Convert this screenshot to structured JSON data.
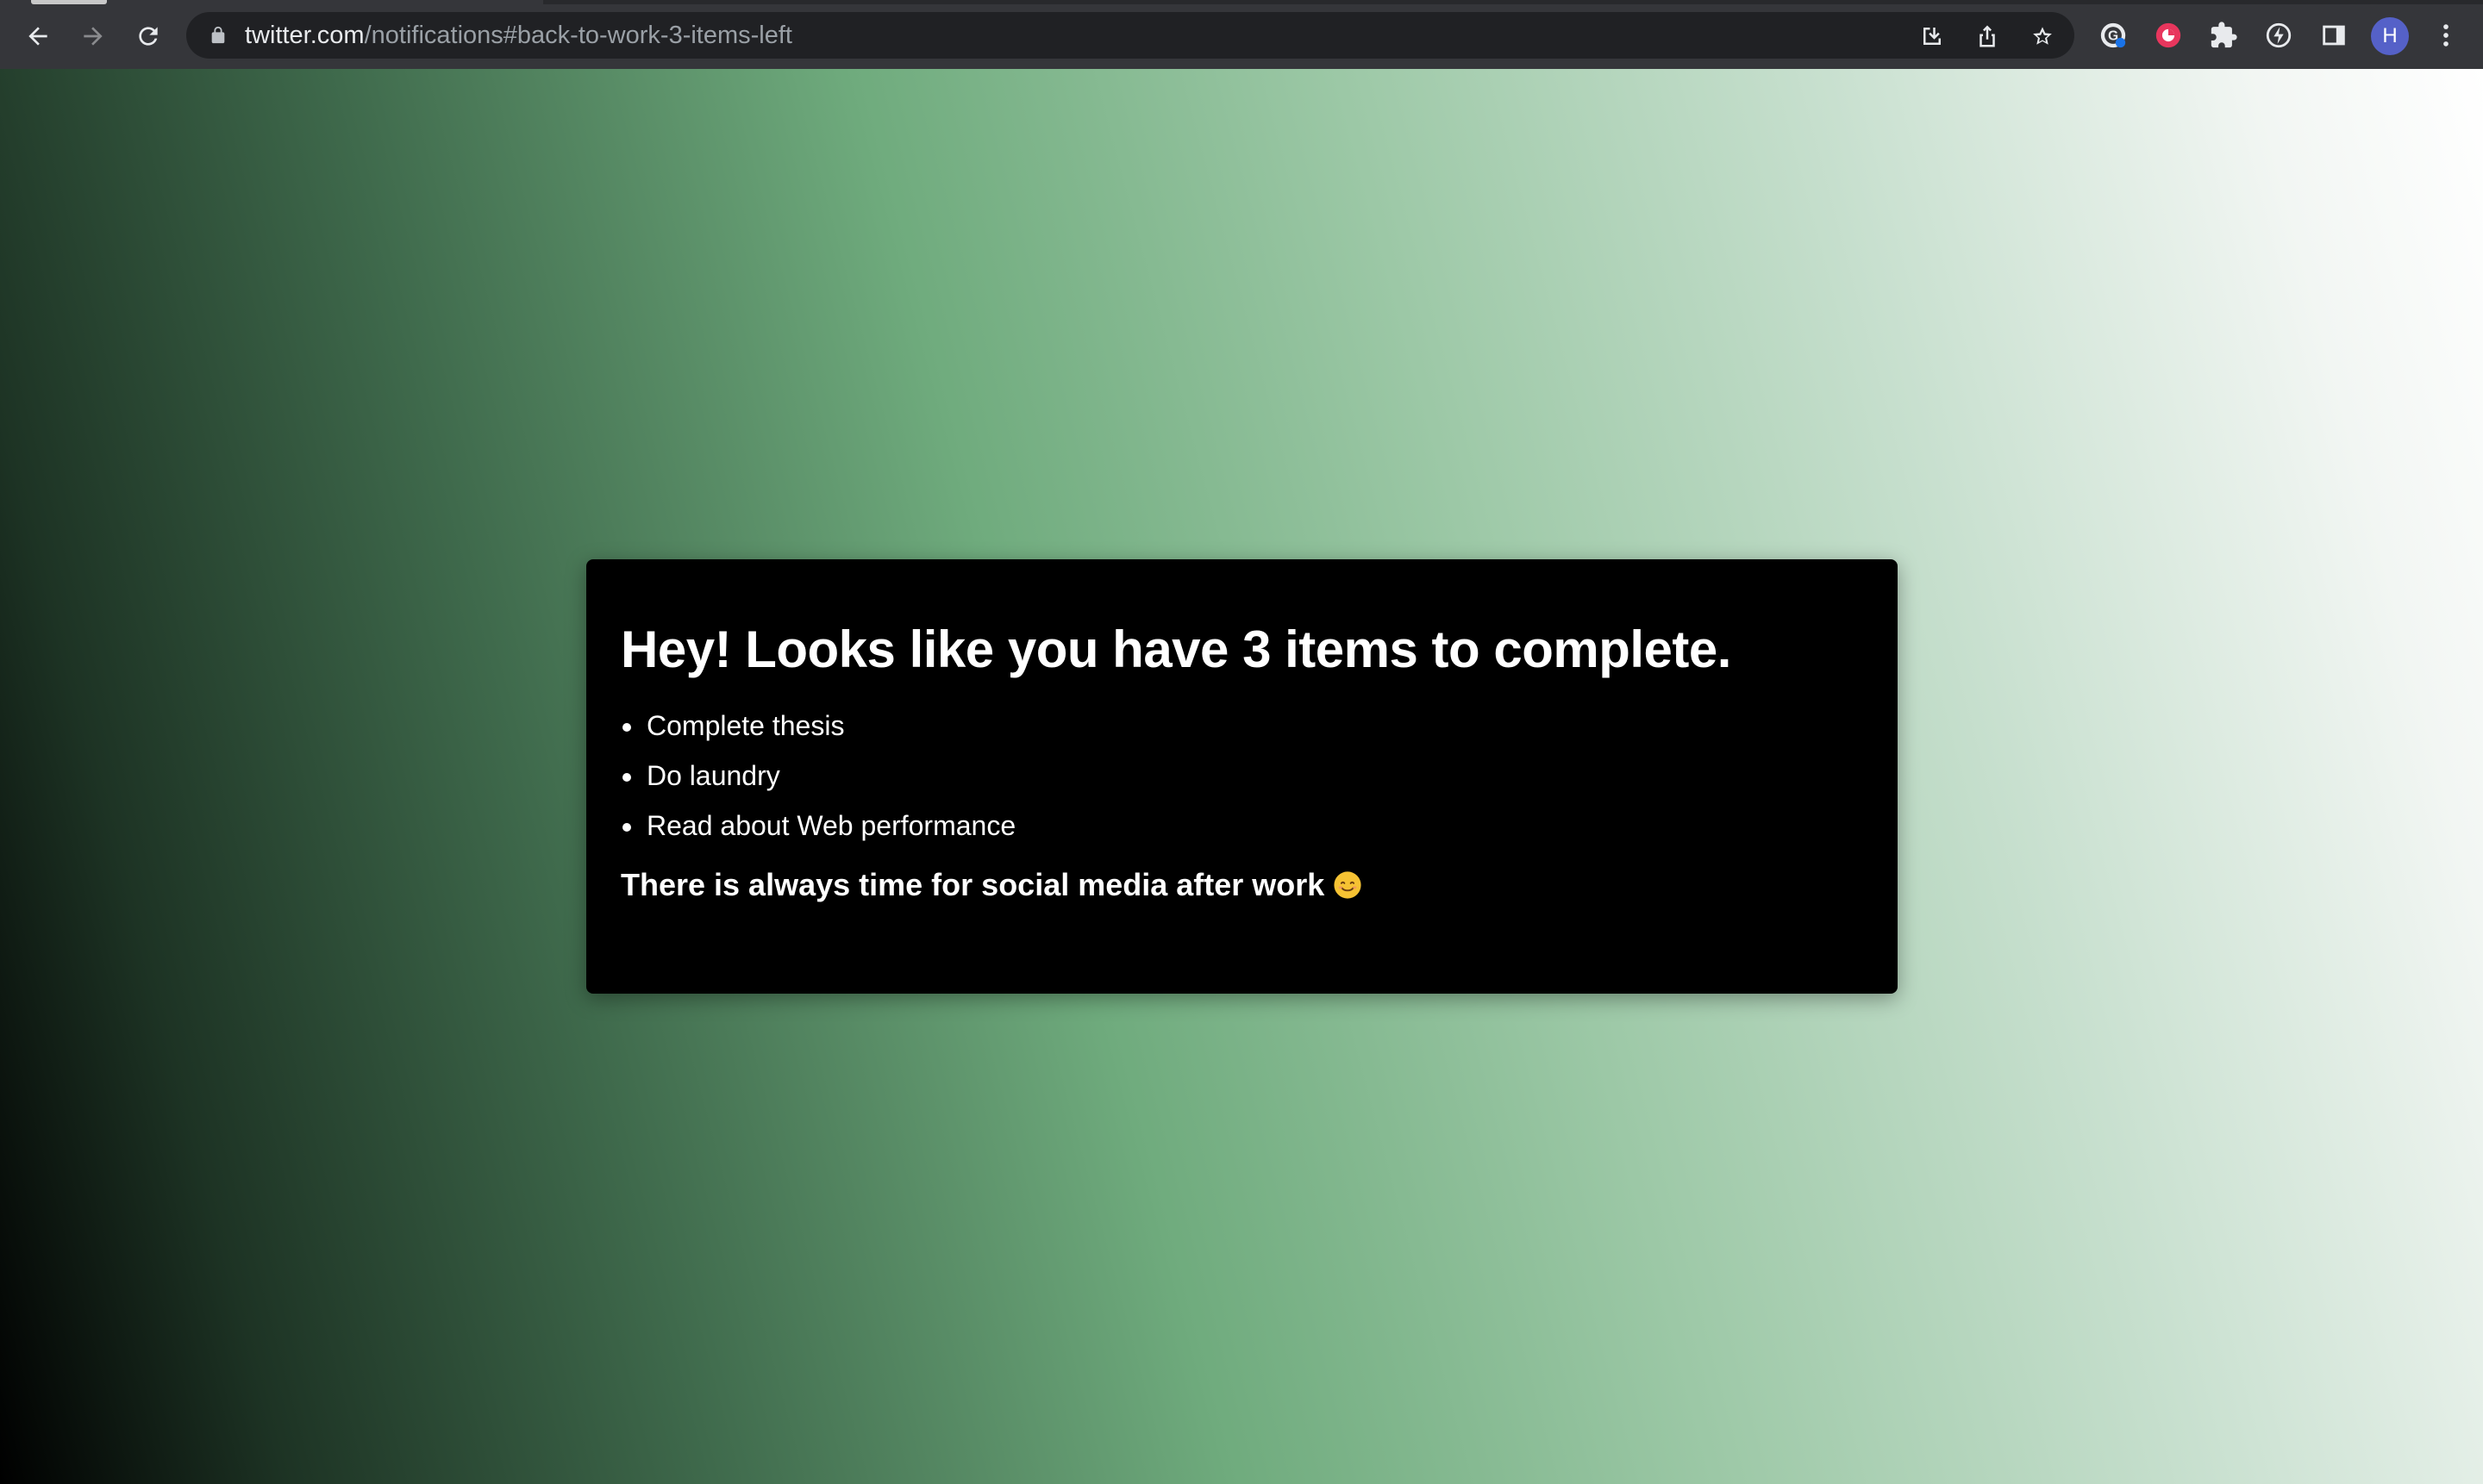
{
  "browser": {
    "url_host": "twitter.com",
    "url_path": "/notifications#back-to-work-3-items-left",
    "profile_initial": "H",
    "icons": {
      "back": "arrow-left-icon",
      "forward": "arrow-right-icon",
      "reload": "reload-icon",
      "lock": "lock-icon",
      "install": "install-app-icon",
      "share": "share-icon",
      "bookmark": "star-icon",
      "extension_1": "grammar-extension-icon",
      "extension_2": "red-circle-extension-icon",
      "extensions": "puzzle-icon",
      "extension_3": "lightning-extension-icon",
      "side_panel": "side-panel-icon",
      "menu": "kebab-menu-icon"
    }
  },
  "card": {
    "heading": "Hey! Looks like you have 3 items to complete.",
    "items": [
      "Complete thesis",
      "Do laundry",
      "Read about Web performance"
    ],
    "footer": "There is always time for social media after work",
    "footer_emoji": "smiling-face-icon"
  },
  "colors": {
    "chrome_bg": "#35363a",
    "omnibox_bg": "#202124",
    "avatar_bg": "#5561c8",
    "card_bg": "#000000",
    "gradient_start": "#000000",
    "gradient_mid": "#6fab7d",
    "gradient_end": "#ffffff"
  }
}
